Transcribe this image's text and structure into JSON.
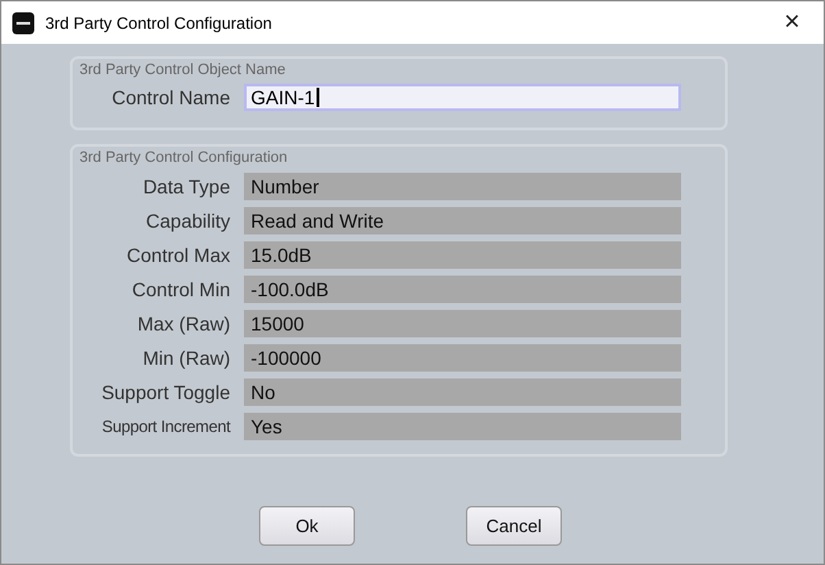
{
  "window": {
    "title": "3rd Party Control Configuration",
    "close": "×"
  },
  "name_group": {
    "title": "3rd Party Control Object Name",
    "label": "Control Name",
    "value": "GAIN-1"
  },
  "config_group": {
    "title": "3rd Party Control Configuration",
    "rows": [
      {
        "label": "Data Type",
        "value": "Number"
      },
      {
        "label": "Capability",
        "value": "Read and Write"
      },
      {
        "label": "Control Max",
        "value": "15.0dB"
      },
      {
        "label": "Control Min",
        "value": "-100.0dB"
      },
      {
        "label": "Max (Raw)",
        "value": "15000"
      },
      {
        "label": "Min (Raw)",
        "value": "-100000"
      },
      {
        "label": "Support Toggle",
        "value": "No"
      },
      {
        "label": "Support Increment",
        "value": "Yes"
      }
    ]
  },
  "buttons": [
    "Ok",
    "Cancel"
  ]
}
